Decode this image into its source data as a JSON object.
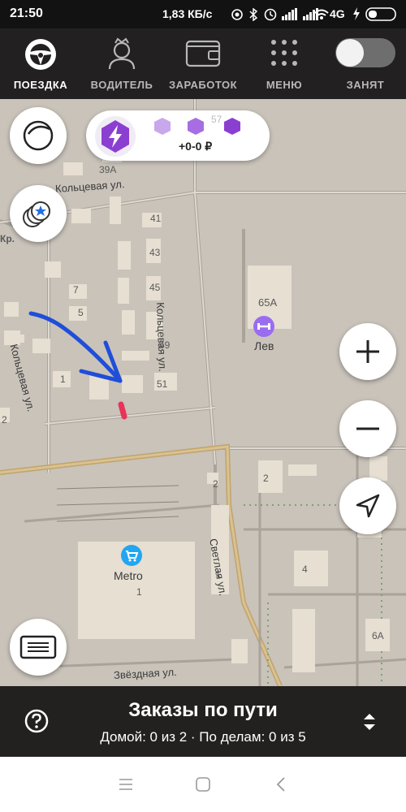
{
  "status_bar": {
    "time": "21:50",
    "speed": "1,83 КБ/с",
    "network": "4G",
    "icons": [
      "alarm-icon",
      "bluetooth-icon",
      "clock-icon",
      "signal-icon",
      "signal-icon",
      "wifi-icon",
      "bolt-icon",
      "battery-icon"
    ]
  },
  "top_nav": {
    "items": [
      {
        "label": "ПОЕЗДКА",
        "icon": "steering-wheel-icon",
        "active": true
      },
      {
        "label": "ВОДИТЕЛЬ",
        "icon": "driver-icon",
        "active": false
      },
      {
        "label": "ЗАРАБОТОК",
        "icon": "wallet-icon",
        "active": false
      },
      {
        "label": "МЕНЮ",
        "icon": "grid-menu-icon",
        "active": false
      },
      {
        "label": "ЗАНЯТ",
        "icon": "toggle-switch",
        "active": false
      }
    ]
  },
  "bonus_pill": {
    "amount": "+0-0 ₽",
    "marker_3": "57"
  },
  "map": {
    "streets": [
      "Кольцевая ул.",
      "Кольцевая ул.",
      "Кольцевая ул.",
      "Светлая ул.",
      "Звёздная ул."
    ],
    "places": [
      {
        "name": "Лев",
        "icon": "gym-icon"
      },
      {
        "name": "Metro",
        "icon": "shopping-cart-icon"
      }
    ],
    "house_numbers": [
      "39А",
      "41",
      "43",
      "45",
      "49",
      "51",
      "65А",
      "7",
      "5",
      "1",
      "2",
      "2",
      "2",
      "1",
      "1",
      "4",
      "6А",
      "3",
      "Кр."
    ],
    "colors": {
      "route": "#1f4ed8",
      "car_marker": "#e8345a",
      "place_icon": "#9a6cf0",
      "shop_icon": "#22a6f2",
      "accent": "#8b3fd0"
    }
  },
  "controls": {
    "zoom_in": "zoom-in-icon",
    "zoom_out": "zoom-out-icon",
    "locate": "navigation-arrow-icon",
    "layers": "layers-icon",
    "favorites": "favorites-icon",
    "list": "list-icon"
  },
  "bottom_panel": {
    "title": "Заказы по пути",
    "subtitle": "Домой: 0 из 2 · По делам: 0 из 5"
  }
}
